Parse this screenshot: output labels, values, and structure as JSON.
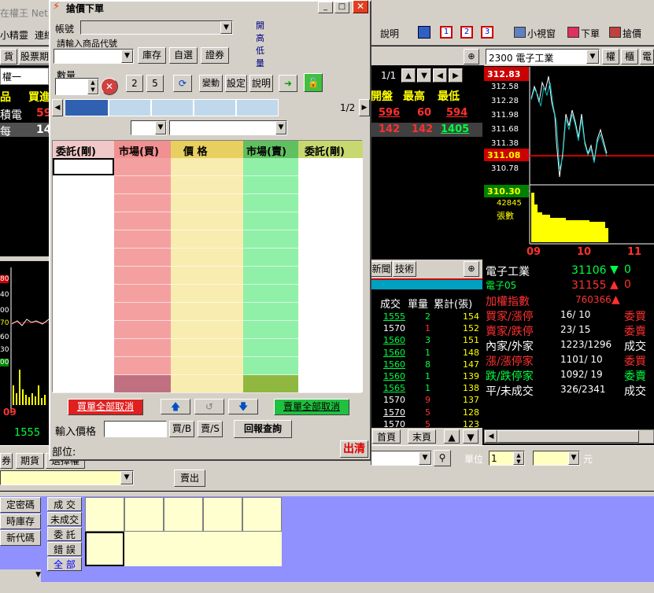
{
  "app_title": "在權王 NetX",
  "top_toolbar": {
    "items": [
      "小精靈",
      "連線"
    ],
    "right_items": [
      "說明",
      "小視窗",
      "下單",
      "搶價"
    ]
  },
  "left_tabs": [
    "貨",
    "股票期"
  ],
  "left_row1": "權一",
  "left_header": [
    "品",
    "買進"
  ],
  "left_rows": [
    {
      "name": "積電",
      "val": "59"
    },
    {
      "name": "每",
      "val": "14"
    }
  ],
  "left_chart_ticks": [
    "80",
    "40",
    "00",
    "70",
    "60",
    "30",
    "00"
  ],
  "left_chart_time": "09",
  "left_bottom_val": "1555",
  "quote_panel": {
    "page": "1/1",
    "headers": [
      "開盤",
      "最高",
      "最低"
    ],
    "values": [
      "596",
      "60",
      "594"
    ],
    "values2": [
      "142",
      "142",
      "1405"
    ]
  },
  "ticks_panel": {
    "tabs": [
      "新聞",
      "技術"
    ],
    "headers": [
      "成交",
      "單量",
      "累計(張)"
    ],
    "rows": [
      [
        "1555",
        "2",
        "154"
      ],
      [
        "1570",
        "1",
        "152"
      ],
      [
        "1560",
        "3",
        "151"
      ],
      [
        "1560",
        "1",
        "148"
      ],
      [
        "1560",
        "8",
        "147"
      ],
      [
        "1560",
        "1",
        "139"
      ],
      [
        "1565",
        "1",
        "138"
      ],
      [
        "1570",
        "9",
        "137"
      ],
      [
        "1570",
        "5",
        "128"
      ],
      [
        "1570",
        "5",
        "123"
      ]
    ],
    "nav": [
      "首頁",
      "末頁"
    ]
  },
  "intraday": {
    "title": "2300 電子工業",
    "btns": [
      "權",
      "櫃",
      "電"
    ],
    "prices": [
      "312.83",
      "312.58",
      "312.28",
      "311.98",
      "311.68",
      "311.38",
      "311.08",
      "310.78",
      "310.30"
    ],
    "volume": "42845",
    "volume_unit": "張數",
    "times": [
      "09",
      "10",
      "11"
    ]
  },
  "index_panel": {
    "rows": [
      {
        "label": "電子工業",
        "value": "31106",
        "arrow": "▼",
        "extra": "0"
      },
      {
        "label": "電子05",
        "value": "31155",
        "arrow": "▲",
        "extra": "0"
      },
      {
        "label": "加權指數",
        "value": "760366",
        "arrow": "▲",
        "extra": ""
      },
      {
        "label": "買家/漲停",
        "value": "16/ 10",
        "arrow": "",
        "extra": "委買"
      },
      {
        "label": "賣家/跌停",
        "value": "23/ 15",
        "arrow": "",
        "extra": "委賣"
      },
      {
        "label": "內家/外家",
        "value": "1223/1296",
        "arrow": "",
        "extra": "成交"
      },
      {
        "label": "漲/漲停家",
        "value": "1101/ 10",
        "arrow": "",
        "extra": "委買"
      },
      {
        "label": "跌/跌停家",
        "value": "1092/ 19",
        "arrow": "",
        "extra": "委賣"
      },
      {
        "label": "平/未成交",
        "value": "326/2341",
        "arrow": "",
        "extra": "成交"
      }
    ]
  },
  "order_bar": {
    "tabs": [
      "券",
      "期貨",
      "選擇權"
    ],
    "unit_label": "單位",
    "unit_value": "1",
    "suffix": "元",
    "sell_btn": "賣出"
  },
  "bottom_left": [
    "定密碼",
    "時庫存",
    "新代碼"
  ],
  "bottom_tabs": [
    "成 交",
    "未成交",
    "委 託",
    "錯 誤",
    "全 部"
  ],
  "dialog": {
    "title": "搶價下單",
    "account_label": "帳號",
    "product_label": "請輸入商品代號",
    "btn_inventory": "庫存",
    "btn_custom": "自選",
    "btn_broker": "證券",
    "info_labels": [
      "開",
      "高",
      "低",
      "量"
    ],
    "qty_label": "數量",
    "qty_btns": [
      "2",
      "5"
    ],
    "tool_btns": [
      "變動",
      "設定",
      "說明"
    ],
    "page": "1/2",
    "grid_headers": [
      "委託(剛)",
      "市場(買)",
      "價 格",
      "市場(賣)",
      "委託(剛)"
    ],
    "cancel_buy": "買單全部取消",
    "cancel_sell": "賣單全部取消",
    "price_label": "輸入價格",
    "buy_btn": "買/B",
    "sell_btn": "賣/S",
    "report_btn": "回報查詢",
    "position_label": "部位:",
    "clear_btn": "出清"
  }
}
